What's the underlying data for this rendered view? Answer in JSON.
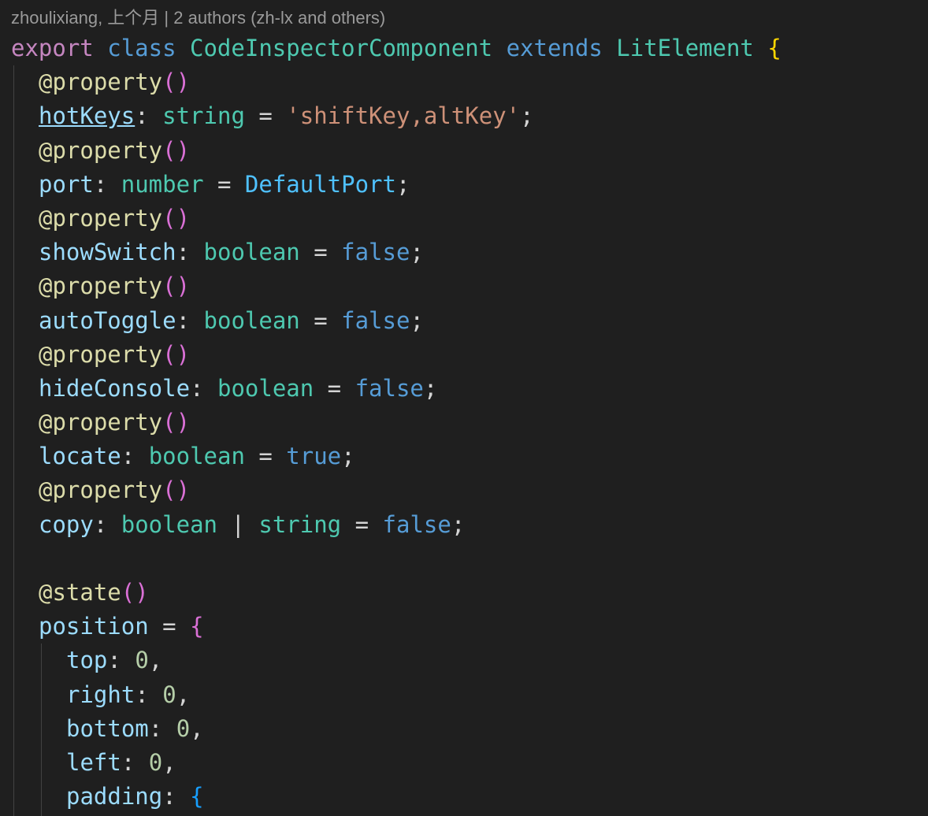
{
  "codelens": "zhoulixiang, 上个月 | 2 authors (zh-lx and others)",
  "colors": {
    "background": "#1f1f1f",
    "keyword": "#569cd6",
    "export_keyword": "#c586c0",
    "class_name": "#4ec9b0",
    "decorator": "#dcdcaa",
    "property": "#9cdcfe",
    "string": "#ce9178",
    "number": "#b5cea8",
    "bracket_level1": "#ffd700",
    "bracket_level2": "#da70d6",
    "bracket_level3": "#179fff"
  },
  "lines": {
    "l0": {
      "t1": "export",
      "t2": " ",
      "t3": "class",
      "t4": " ",
      "t5": "CodeInspectorComponent",
      "t6": " ",
      "t7": "extends",
      "t8": " ",
      "t9": "LitElement",
      "t10": " ",
      "t11": "{"
    },
    "l1": {
      "t1": "@property",
      "t2": "()"
    },
    "l2": {
      "t1": "hotKeys",
      "t2": ": ",
      "t3": "string",
      "t4": " = ",
      "t5": "'shiftKey,altKey'",
      "t6": ";"
    },
    "l3": {
      "t1": "@property",
      "t2": "()"
    },
    "l4": {
      "t1": "port",
      "t2": ": ",
      "t3": "number",
      "t4": " = ",
      "t5": "DefaultPort",
      "t6": ";"
    },
    "l5": {
      "t1": "@property",
      "t2": "()"
    },
    "l6": {
      "t1": "showSwitch",
      "t2": ": ",
      "t3": "boolean",
      "t4": " = ",
      "t5": "false",
      "t6": ";"
    },
    "l7": {
      "t1": "@property",
      "t2": "()"
    },
    "l8": {
      "t1": "autoToggle",
      "t2": ": ",
      "t3": "boolean",
      "t4": " = ",
      "t5": "false",
      "t6": ";"
    },
    "l9": {
      "t1": "@property",
      "t2": "()"
    },
    "l10": {
      "t1": "hideConsole",
      "t2": ": ",
      "t3": "boolean",
      "t4": " = ",
      "t5": "false",
      "t6": ";"
    },
    "l11": {
      "t1": "@property",
      "t2": "()"
    },
    "l12": {
      "t1": "locate",
      "t2": ": ",
      "t3": "boolean",
      "t4": " = ",
      "t5": "true",
      "t6": ";"
    },
    "l13": {
      "t1": "@property",
      "t2": "()"
    },
    "l14": {
      "t1": "copy",
      "t2": ": ",
      "t3": "boolean",
      "t4": " | ",
      "t5": "string",
      "t6": " = ",
      "t7": "false",
      "t8": ";"
    },
    "l15": {},
    "l16": {
      "t1": "@state",
      "t2": "()"
    },
    "l17": {
      "t1": "position",
      "t2": " = ",
      "t3": "{"
    },
    "l18": {
      "t1": "top",
      "t2": ": ",
      "t3": "0",
      "t4": ","
    },
    "l19": {
      "t1": "right",
      "t2": ": ",
      "t3": "0",
      "t4": ","
    },
    "l20": {
      "t1": "bottom",
      "t2": ": ",
      "t3": "0",
      "t4": ","
    },
    "l21": {
      "t1": "left",
      "t2": ": ",
      "t3": "0",
      "t4": ","
    },
    "l22": {
      "t1": "padding",
      "t2": ": ",
      "t3": "{"
    }
  }
}
